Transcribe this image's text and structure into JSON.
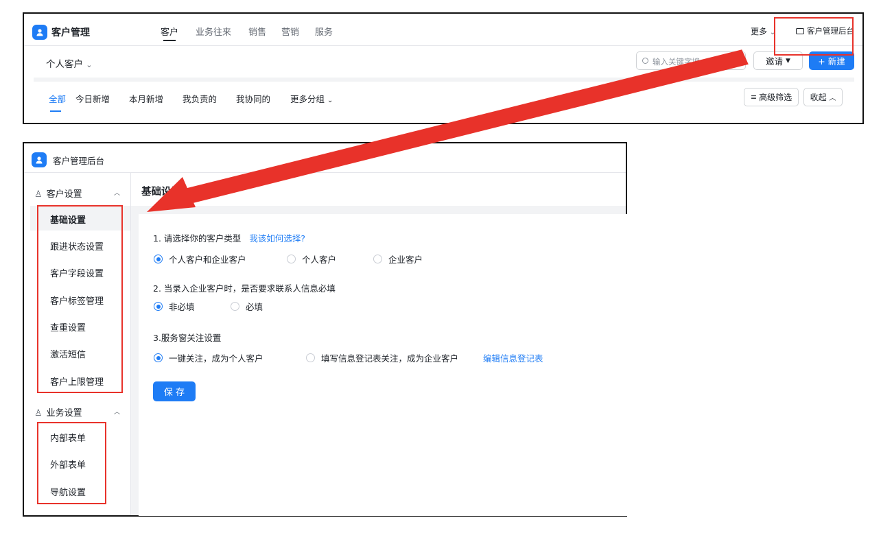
{
  "top": {
    "app_title": "客户管理",
    "nav": [
      "客户",
      "业务往来",
      "销售",
      "营销",
      "服务"
    ],
    "more": "更多",
    "admin_link": "客户管理后台",
    "view_selector": "个人客户",
    "search_placeholder": "输入关键字搜",
    "invite_button": "邀请",
    "new_button": "+ 新建",
    "tabs": [
      "全部",
      "今日新增",
      "本月新增",
      "我负责的",
      "我协同的",
      "更多分组"
    ],
    "filter_button": "高级筛选",
    "collapse_button": "收起"
  },
  "admin": {
    "title": "客户管理后台",
    "customer_settings": "客户设置",
    "customer_items": [
      "基础设置",
      "跟进状态设置",
      "客户字段设置",
      "客户标签管理",
      "查重设置",
      "激活短信",
      "客户上限管理"
    ],
    "business_settings": "业务设置",
    "business_items": [
      "内部表单",
      "外部表单",
      "导航设置"
    ],
    "page_heading": "基础设置",
    "q1": "1. 请选择你的客户类型",
    "q1_link": "我该如何选择?",
    "q1_options": [
      "个人客户和企业客户",
      "个人客户",
      "企业客户"
    ],
    "q2": "2. 当录入企业客户时，是否要求联系人信息必填",
    "q2_options": [
      "非必填",
      "必填"
    ],
    "q3": "3.服务窗关注设置",
    "q3_options": [
      "一键关注，成为个人客户",
      "填写信息登记表关注，成为企业客户"
    ],
    "q3_link": "编辑信息登记表",
    "save_button": "保 存"
  },
  "colors": {
    "accent": "#1e7cf5",
    "annotation": "#e8322a"
  }
}
